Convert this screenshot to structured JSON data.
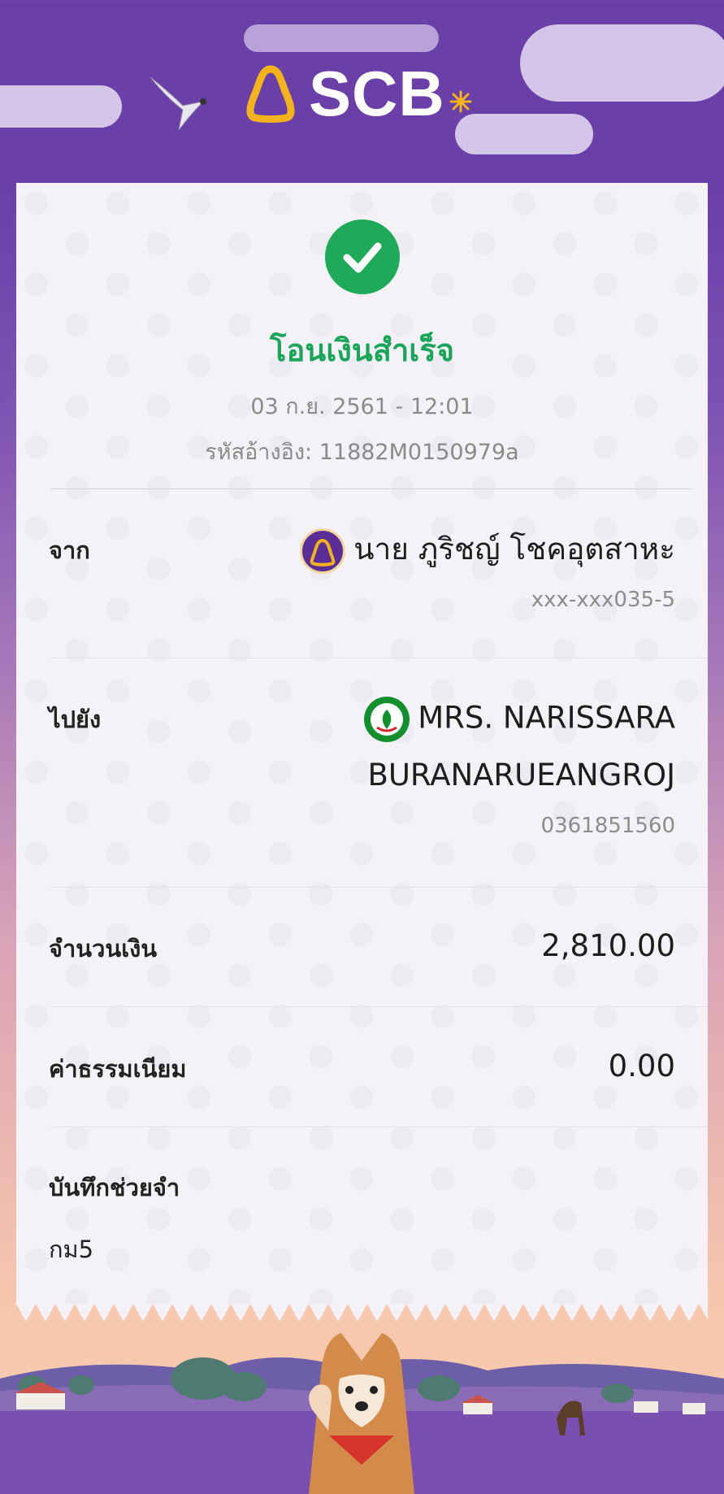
{
  "header": {
    "brand": "SCB"
  },
  "status": {
    "title": "โอนเงินสำเร็จ",
    "datetime": "03 ก.ย. 2561 - 12:01",
    "reference": "รหัสอ้างอิง: 11882M0150979a"
  },
  "from": {
    "label": "จาก",
    "name": "นาย ภูริชญ์ โชคอุตสาหะ",
    "account": "xxx-xxx035-5"
  },
  "to": {
    "label": "ไปยัง",
    "name_line1": "MRS. NARISSARA",
    "name_line2": "BURANARUEANGROJ",
    "account": "0361851560"
  },
  "amount": {
    "label": "จำนวนเงิน",
    "value": "2,810.00"
  },
  "fee": {
    "label": "ค่าธรรมเนียม",
    "value": "0.00"
  },
  "memo": {
    "label": "บันทึกช่วยจำ",
    "value": "กม5"
  },
  "colors": {
    "purple": "#6b3fa8",
    "success": "#1aa55a",
    "kbank_green": "#138f2d"
  }
}
